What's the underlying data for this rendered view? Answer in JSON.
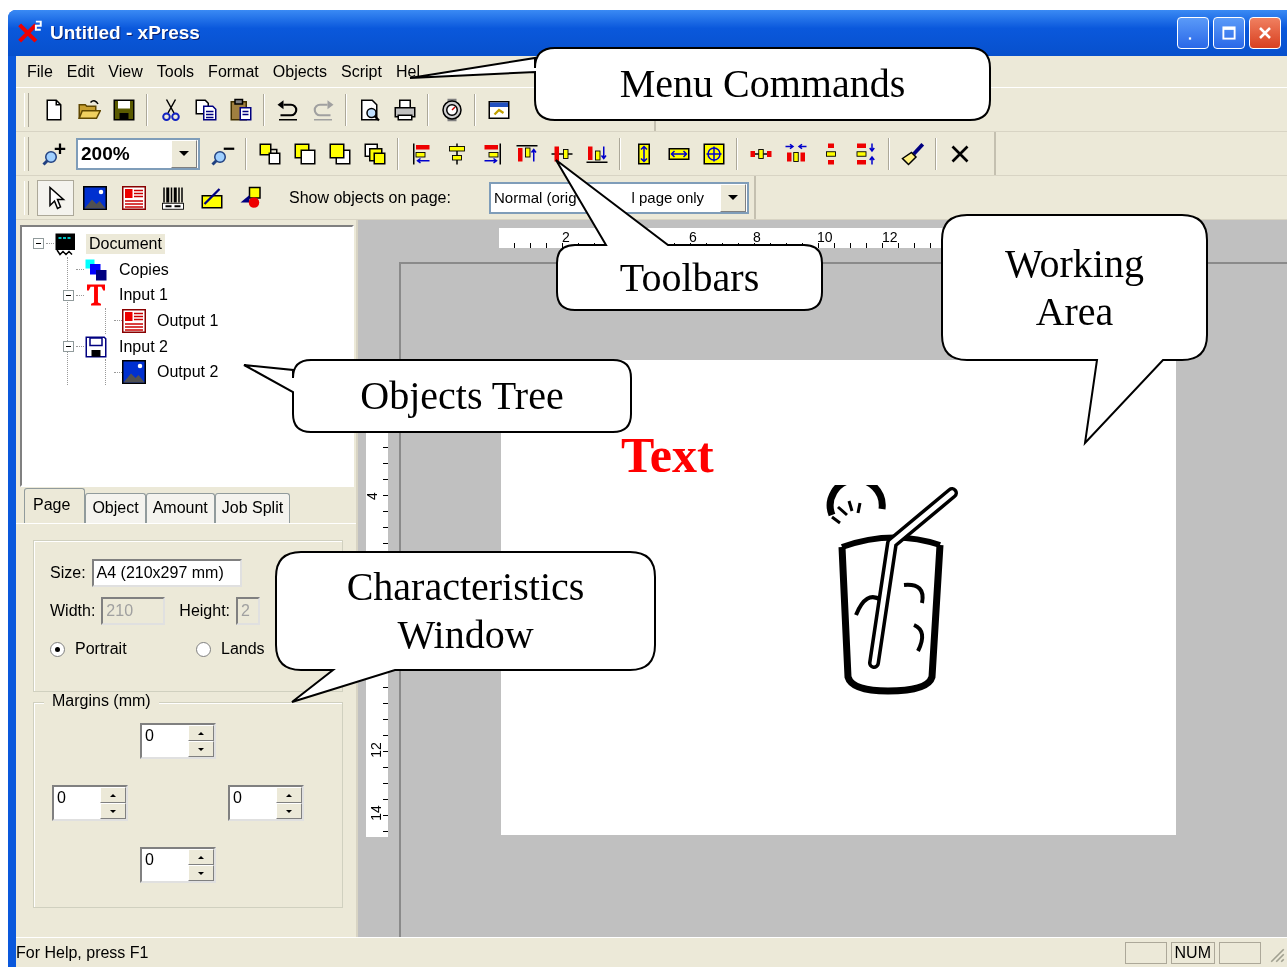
{
  "window": {
    "title": "Untitled - xPress"
  },
  "menu": [
    {
      "label": "File"
    },
    {
      "label": "Edit"
    },
    {
      "label": "View"
    },
    {
      "label": "Tools"
    },
    {
      "label": "Format"
    },
    {
      "label": "Objects"
    },
    {
      "label": "Script"
    },
    {
      "label": "Hel"
    }
  ],
  "zoom_combo": {
    "value": "200%"
  },
  "show_objects": {
    "label": "Show objects on page:",
    "value_parts": [
      "Normal (orig",
      "l page only"
    ]
  },
  "tree": [
    {
      "kind": "document",
      "label": "Document",
      "selected": true,
      "expanded": true,
      "children": [
        {
          "kind": "copies",
          "label": "Copies",
          "selected": false
        },
        {
          "kind": "text-input",
          "label": "Input 1",
          "selected": false,
          "expanded": true,
          "children": [
            {
              "kind": "text-output",
              "label": "Output 1",
              "selected": false
            }
          ]
        },
        {
          "kind": "file-input",
          "label": "Input 2",
          "selected": false,
          "expanded": true,
          "children": [
            {
              "kind": "image-output",
              "label": "Output 2",
              "selected": false
            }
          ]
        }
      ]
    }
  ],
  "tabs": [
    {
      "label": "Page",
      "selected": true
    },
    {
      "label": "Object",
      "selected": false
    },
    {
      "label": "Amount",
      "selected": false
    },
    {
      "label": "Job Split",
      "selected": false
    }
  ],
  "page_tab": {
    "size": {
      "label": "Size:",
      "value": "A4 (210x297 mm)"
    },
    "width": {
      "label": "Width:",
      "value": "210",
      "disabled": true
    },
    "height": {
      "label": "Height:",
      "value": "2",
      "disabled": true
    },
    "orientation": [
      {
        "label": "Portrait",
        "selected": true
      },
      {
        "label": "Lands",
        "selected": false
      }
    ],
    "margins": {
      "label": "Margins (mm)",
      "fields": [
        {
          "value": "0"
        },
        {
          "value": "0"
        },
        {
          "value": "0"
        },
        {
          "value": "0"
        }
      ]
    }
  },
  "canvas": {
    "horizontal_ruler": [
      "2",
      "6",
      "8",
      "10",
      "12"
    ],
    "vertical_ruler": [
      "4",
      "12",
      "14"
    ],
    "text_object": "Text"
  },
  "callouts": [
    {
      "kind": "menu",
      "text": "Menu Commands"
    },
    {
      "kind": "toolbars",
      "text": "Toolbars"
    },
    {
      "kind": "working-area",
      "text": "Working Area"
    },
    {
      "kind": "tree",
      "text": "Objects Tree"
    },
    {
      "kind": "characteristics",
      "text": "Characteristics Window"
    }
  ],
  "status_bar": {
    "text": "For Help, press F1",
    "indicators": [
      "NUM"
    ]
  }
}
